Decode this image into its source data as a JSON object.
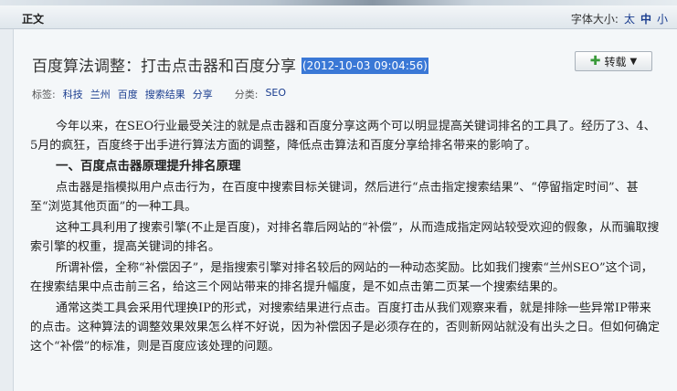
{
  "header": {
    "title": "正文",
    "font_size_label": "字体大小:",
    "font_sizes": [
      "太",
      "中",
      "小"
    ]
  },
  "post": {
    "title": "百度算法调整：打击点击器和百度分享",
    "date": "(2012-10-03 09:04:56)",
    "repost_label": "转载",
    "tags_label": "标签:",
    "tags": [
      "科技",
      "兰州",
      "百度",
      "搜索结果",
      "分享"
    ],
    "category_label": "分类:",
    "category": "SEO"
  },
  "content": {
    "p1": "今年以来，在SEO行业最受关注的就是点击器和百度分享这两个可以明显提高关键词排名的工具了。经历了3、4、5月的疯狂，百度终于出手进行算法方面的调整，降低点击算法和百度分享给排名带来的影响了。",
    "h1": "一、百度点击器原理提升排名原理",
    "p2": "点击器是指模拟用户点击行为，在百度中搜索目标关键词，然后进行“点击指定搜索结果”、“停留指定时间”、甚至“浏览其他页面”的一种工具。",
    "p3": "这种工具利用了搜索引擎(不止是百度)，对排名靠后网站的“补偿”，从而造成指定网站较受欢迎的假象，从而骗取搜索引擎的权重，提高关键词的排名。",
    "p4": "所谓补偿，全称“补偿因子”，是指搜索引擎对排名较后的网站的一种动态奖励。比如我们搜索“兰州SEO”这个词，在搜索结果中点击前三名，给这三个网站带来的排名提升幅度，是不如点击第二页某一个搜索结果的。",
    "p5": "通常这类工具会采用代理换IP的形式，对搜索结果进行点击。百度打击从我们观察来看，就是排除一些异常IP带来的点击。这种算法的调整效果效果怎么样不好说，因为补偿因子是必须存在的，否则新网站就没有出头之日。但如何确定这个“补偿”的标准，则是百度应该处理的问题。"
  },
  "colors": {
    "link": "#1a3d8f",
    "date_highlight": "#3a78d6",
    "plus": "#3a9a3a"
  }
}
